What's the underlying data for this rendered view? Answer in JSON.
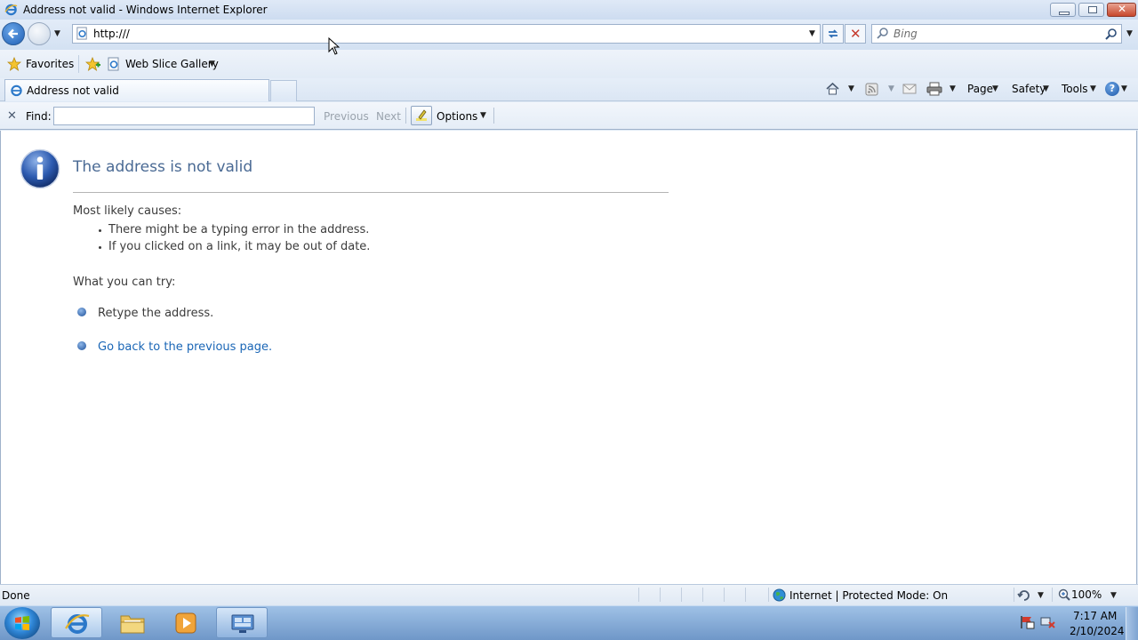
{
  "window": {
    "title": "Address not valid - Windows Internet Explorer"
  },
  "nav": {
    "address": "http:///",
    "search_placeholder": "Bing"
  },
  "favorites_bar": {
    "favorites_label": "Favorites",
    "web_slice_label": "Web Slice Gallery"
  },
  "tabs": [
    {
      "label": "Address not valid"
    }
  ],
  "command_bar": {
    "page_label": "Page",
    "safety_label": "Safety",
    "tools_label": "Tools"
  },
  "find_bar": {
    "find_label": "Find:",
    "find_value": "",
    "previous_label": "Previous",
    "next_label": "Next",
    "options_label": "Options"
  },
  "content": {
    "title": "The address is not valid",
    "causes_label": "Most likely causes:",
    "causes": [
      "There might be a typing error in the address.",
      "If you clicked on a link, it may be out of date."
    ],
    "try_label": "What you can try:",
    "try_items": [
      "Retype the address.",
      "Go back to the previous page."
    ]
  },
  "status_bar": {
    "status": "Done",
    "zone": "Internet | Protected Mode: On",
    "zoom": "100%"
  },
  "taskbar": {
    "time": "7:17 AM",
    "date": "2/10/2024"
  },
  "colors": {
    "title_text": "#4a6a94",
    "link": "#1a66b6"
  }
}
